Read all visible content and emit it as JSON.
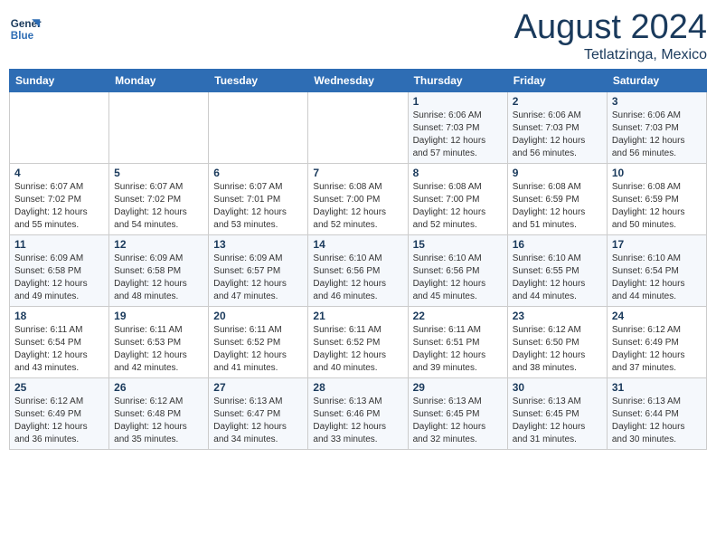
{
  "logo": {
    "name": "General",
    "name2": "Blue"
  },
  "title": {
    "month_year": "August 2024",
    "location": "Tetlatzinga, Mexico"
  },
  "weekdays": [
    "Sunday",
    "Monday",
    "Tuesday",
    "Wednesday",
    "Thursday",
    "Friday",
    "Saturday"
  ],
  "weeks": [
    [
      {
        "day": "",
        "info": ""
      },
      {
        "day": "",
        "info": ""
      },
      {
        "day": "",
        "info": ""
      },
      {
        "day": "",
        "info": ""
      },
      {
        "day": "1",
        "info": "Sunrise: 6:06 AM\nSunset: 7:03 PM\nDaylight: 12 hours\nand 57 minutes."
      },
      {
        "day": "2",
        "info": "Sunrise: 6:06 AM\nSunset: 7:03 PM\nDaylight: 12 hours\nand 56 minutes."
      },
      {
        "day": "3",
        "info": "Sunrise: 6:06 AM\nSunset: 7:03 PM\nDaylight: 12 hours\nand 56 minutes."
      }
    ],
    [
      {
        "day": "4",
        "info": "Sunrise: 6:07 AM\nSunset: 7:02 PM\nDaylight: 12 hours\nand 55 minutes."
      },
      {
        "day": "5",
        "info": "Sunrise: 6:07 AM\nSunset: 7:02 PM\nDaylight: 12 hours\nand 54 minutes."
      },
      {
        "day": "6",
        "info": "Sunrise: 6:07 AM\nSunset: 7:01 PM\nDaylight: 12 hours\nand 53 minutes."
      },
      {
        "day": "7",
        "info": "Sunrise: 6:08 AM\nSunset: 7:00 PM\nDaylight: 12 hours\nand 52 minutes."
      },
      {
        "day": "8",
        "info": "Sunrise: 6:08 AM\nSunset: 7:00 PM\nDaylight: 12 hours\nand 52 minutes."
      },
      {
        "day": "9",
        "info": "Sunrise: 6:08 AM\nSunset: 6:59 PM\nDaylight: 12 hours\nand 51 minutes."
      },
      {
        "day": "10",
        "info": "Sunrise: 6:08 AM\nSunset: 6:59 PM\nDaylight: 12 hours\nand 50 minutes."
      }
    ],
    [
      {
        "day": "11",
        "info": "Sunrise: 6:09 AM\nSunset: 6:58 PM\nDaylight: 12 hours\nand 49 minutes."
      },
      {
        "day": "12",
        "info": "Sunrise: 6:09 AM\nSunset: 6:58 PM\nDaylight: 12 hours\nand 48 minutes."
      },
      {
        "day": "13",
        "info": "Sunrise: 6:09 AM\nSunset: 6:57 PM\nDaylight: 12 hours\nand 47 minutes."
      },
      {
        "day": "14",
        "info": "Sunrise: 6:10 AM\nSunset: 6:56 PM\nDaylight: 12 hours\nand 46 minutes."
      },
      {
        "day": "15",
        "info": "Sunrise: 6:10 AM\nSunset: 6:56 PM\nDaylight: 12 hours\nand 45 minutes."
      },
      {
        "day": "16",
        "info": "Sunrise: 6:10 AM\nSunset: 6:55 PM\nDaylight: 12 hours\nand 44 minutes."
      },
      {
        "day": "17",
        "info": "Sunrise: 6:10 AM\nSunset: 6:54 PM\nDaylight: 12 hours\nand 44 minutes."
      }
    ],
    [
      {
        "day": "18",
        "info": "Sunrise: 6:11 AM\nSunset: 6:54 PM\nDaylight: 12 hours\nand 43 minutes."
      },
      {
        "day": "19",
        "info": "Sunrise: 6:11 AM\nSunset: 6:53 PM\nDaylight: 12 hours\nand 42 minutes."
      },
      {
        "day": "20",
        "info": "Sunrise: 6:11 AM\nSunset: 6:52 PM\nDaylight: 12 hours\nand 41 minutes."
      },
      {
        "day": "21",
        "info": "Sunrise: 6:11 AM\nSunset: 6:52 PM\nDaylight: 12 hours\nand 40 minutes."
      },
      {
        "day": "22",
        "info": "Sunrise: 6:11 AM\nSunset: 6:51 PM\nDaylight: 12 hours\nand 39 minutes."
      },
      {
        "day": "23",
        "info": "Sunrise: 6:12 AM\nSunset: 6:50 PM\nDaylight: 12 hours\nand 38 minutes."
      },
      {
        "day": "24",
        "info": "Sunrise: 6:12 AM\nSunset: 6:49 PM\nDaylight: 12 hours\nand 37 minutes."
      }
    ],
    [
      {
        "day": "25",
        "info": "Sunrise: 6:12 AM\nSunset: 6:49 PM\nDaylight: 12 hours\nand 36 minutes."
      },
      {
        "day": "26",
        "info": "Sunrise: 6:12 AM\nSunset: 6:48 PM\nDaylight: 12 hours\nand 35 minutes."
      },
      {
        "day": "27",
        "info": "Sunrise: 6:13 AM\nSunset: 6:47 PM\nDaylight: 12 hours\nand 34 minutes."
      },
      {
        "day": "28",
        "info": "Sunrise: 6:13 AM\nSunset: 6:46 PM\nDaylight: 12 hours\nand 33 minutes."
      },
      {
        "day": "29",
        "info": "Sunrise: 6:13 AM\nSunset: 6:45 PM\nDaylight: 12 hours\nand 32 minutes."
      },
      {
        "day": "30",
        "info": "Sunrise: 6:13 AM\nSunset: 6:45 PM\nDaylight: 12 hours\nand 31 minutes."
      },
      {
        "day": "31",
        "info": "Sunrise: 6:13 AM\nSunset: 6:44 PM\nDaylight: 12 hours\nand 30 minutes."
      }
    ]
  ]
}
